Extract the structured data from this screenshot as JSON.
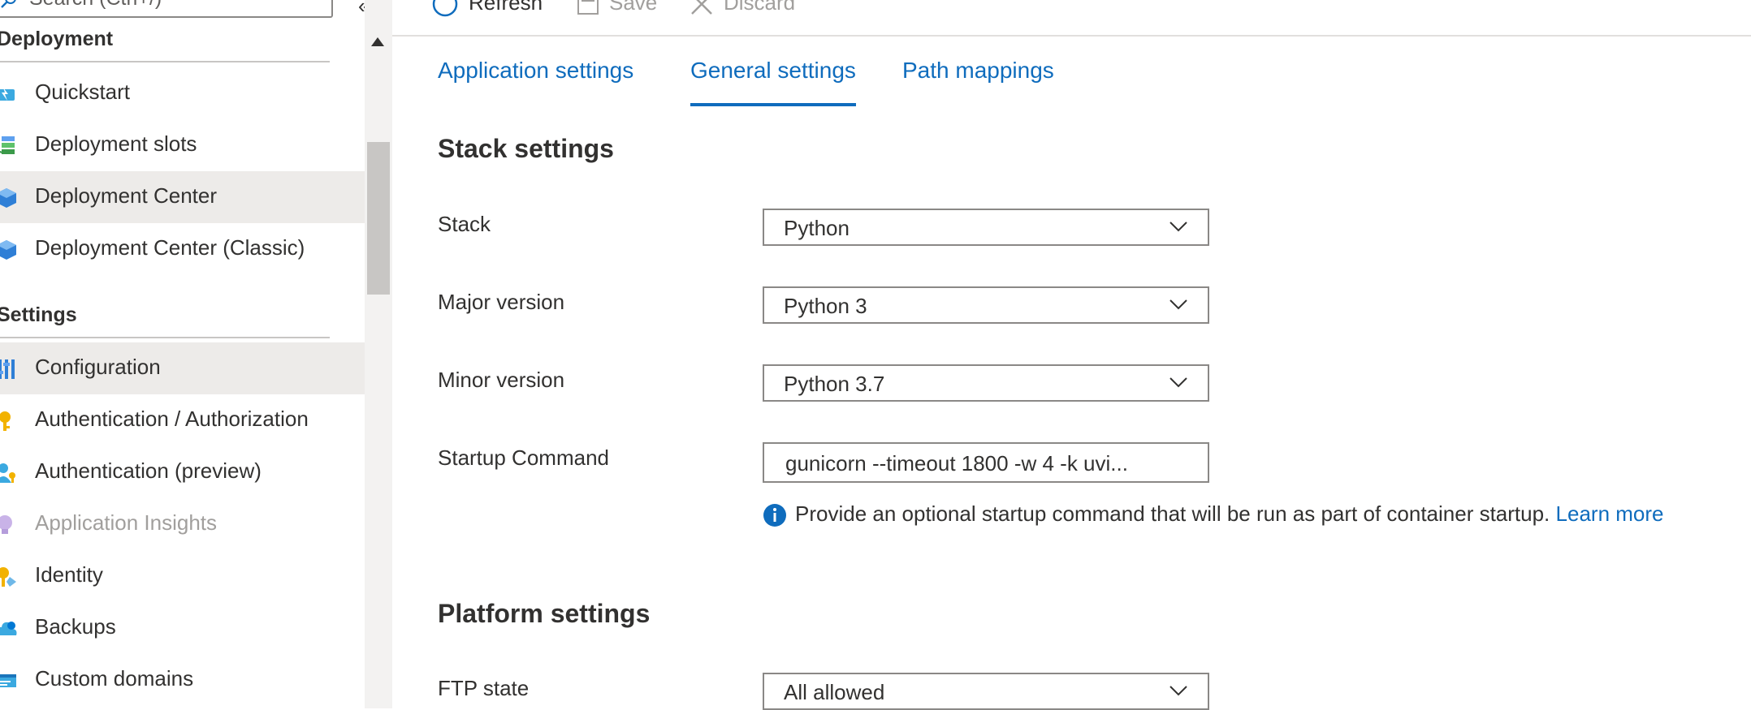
{
  "search": {
    "placeholder": "Search (Ctrl+/)"
  },
  "sidebar": {
    "sections": [
      {
        "header": "Deployment",
        "items": [
          {
            "label": "Quickstart",
            "icon": "quickstart-icon"
          },
          {
            "label": "Deployment slots",
            "icon": "deployment-slots-icon"
          },
          {
            "label": "Deployment Center",
            "icon": "deployment-center-icon"
          },
          {
            "label": "Deployment Center (Classic)",
            "icon": "deployment-center-classic-icon"
          }
        ]
      },
      {
        "header": "Settings",
        "items": [
          {
            "label": "Configuration",
            "icon": "configuration-icon"
          },
          {
            "label": "Authentication / Authorization",
            "icon": "key-icon"
          },
          {
            "label": "Authentication (preview)",
            "icon": "user-key-icon"
          },
          {
            "label": "Application Insights",
            "icon": "lightbulb-icon"
          },
          {
            "label": "Identity",
            "icon": "identity-icon"
          },
          {
            "label": "Backups",
            "icon": "cloud-backup-icon"
          },
          {
            "label": "Custom domains",
            "icon": "domain-icon"
          }
        ]
      }
    ]
  },
  "toolbar": {
    "refresh": "Refresh",
    "save": "Save",
    "discard": "Discard"
  },
  "tabs": [
    {
      "label": "Application settings"
    },
    {
      "label": "General settings"
    },
    {
      "label": "Path mappings"
    }
  ],
  "stack_settings": {
    "heading": "Stack settings",
    "stack": {
      "label": "Stack",
      "value": "Python"
    },
    "major_version": {
      "label": "Major version",
      "value": "Python 3"
    },
    "minor_version": {
      "label": "Minor version",
      "value": "Python 3.7"
    },
    "startup_command": {
      "label": "Startup Command",
      "value": "gunicorn --timeout 1800 -w 4 -k uvi...",
      "info": "Provide an optional startup command that will be run as part of container startup.",
      "learn_more": "Learn more"
    }
  },
  "platform_settings": {
    "heading": "Platform settings",
    "ftp_state": {
      "label": "FTP state",
      "value": "All allowed"
    }
  },
  "colors": {
    "accent": "#0f6cbd",
    "selected_bg": "#edebe9",
    "disabled_text": "#a19f9d"
  }
}
